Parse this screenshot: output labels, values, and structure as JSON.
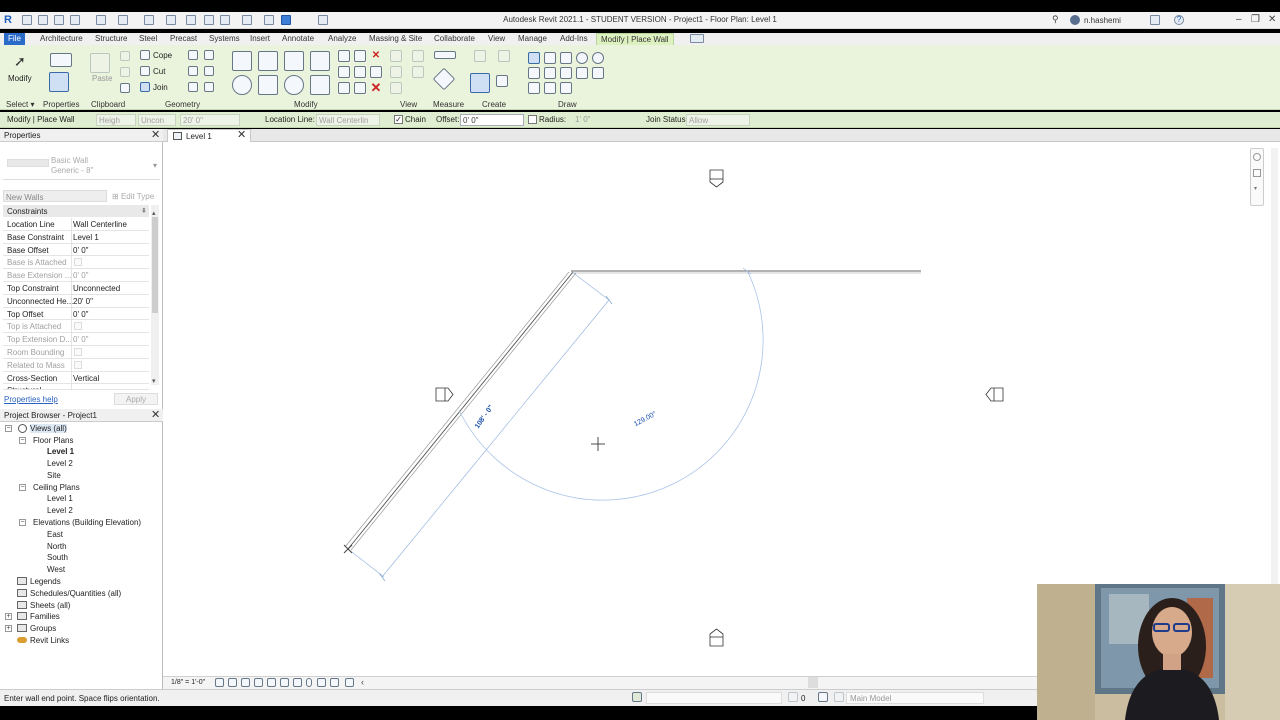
{
  "window": {
    "title": "Autodesk Revit 2021.1 - STUDENT VERSION - Project1 - Floor Plan: Level 1",
    "user": "n.hashemi"
  },
  "ribbon_tabs": [
    "File",
    "Architecture",
    "Structure",
    "Steel",
    "Precast",
    "Systems",
    "Insert",
    "Annotate",
    "Analyze",
    "Massing & Site",
    "Collaborate",
    "View",
    "Manage",
    "Add-Ins",
    "Modify | Place Wall"
  ],
  "ribbon": {
    "modify_label": "Modify",
    "paste_label": "Paste",
    "cope_label": "Cope",
    "cut_label": "Cut",
    "join_label": "Join",
    "panels": {
      "select": "Select",
      "properties": "Properties",
      "clipboard": "Clipboard",
      "geometry": "Geometry",
      "modify": "Modify",
      "view": "View",
      "measure": "Measure",
      "create": "Create",
      "draw": "Draw"
    }
  },
  "options_bar": {
    "context": "Modify | Place Wall",
    "height_label": "Heigh",
    "height_mode": "Uncon",
    "height_value": "20' 0\"",
    "location_line_label": "Location Line:",
    "location_line_value": "Wall Centerlin",
    "chain_label": "Chain",
    "chain_checked": true,
    "offset_label": "Offset:",
    "offset_value": "0' 0\"",
    "radius_label": "Radius:",
    "radius_checked": false,
    "radius_value": "1' 0\"",
    "join_status_label": "Join Status:",
    "join_status_value": "Allow"
  },
  "properties": {
    "title": "Properties",
    "type_family": "Basic Wall",
    "type_name": "Generic - 8\"",
    "instance_filter": "New Walls",
    "edit_type": "Edit Type",
    "section": "Constraints",
    "rows": [
      {
        "k": "Location Line",
        "v": "Wall Centerline"
      },
      {
        "k": "Base Constraint",
        "v": "Level 1"
      },
      {
        "k": "Base Offset",
        "v": "0' 0\""
      },
      {
        "k": "Base is Attached",
        "v": ""
      },
      {
        "k": "Base Extension ...",
        "v": "0' 0\""
      },
      {
        "k": "Top Constraint",
        "v": "Unconnected"
      },
      {
        "k": "Unconnected He...",
        "v": "20' 0\""
      },
      {
        "k": "Top Offset",
        "v": "0' 0\""
      },
      {
        "k": "Top is Attached",
        "v": ""
      },
      {
        "k": "Top Extension D...",
        "v": "0' 0\""
      },
      {
        "k": "Room Bounding",
        "v": ""
      },
      {
        "k": "Related to Mass",
        "v": ""
      },
      {
        "k": "Cross-Section",
        "v": "Vertical"
      },
      {
        "k": "Structural",
        "v": ""
      }
    ],
    "help_link": "Properties help",
    "apply_button": "Apply"
  },
  "project_browser": {
    "title": "Project Browser - Project1",
    "views_all": "Views (all)",
    "floor_plans": "Floor Plans",
    "fp_level1": "Level 1",
    "fp_level2": "Level 2",
    "fp_site": "Site",
    "ceiling_plans": "Ceiling Plans",
    "cp_level1": "Level 1",
    "cp_level2": "Level 2",
    "elevations": "Elevations (Building Elevation)",
    "el_east": "East",
    "el_north": "North",
    "el_south": "South",
    "el_west": "West",
    "legends": "Legends",
    "schedules": "Schedules/Quantities (all)",
    "sheets": "Sheets (all)",
    "families": "Families",
    "groups": "Groups",
    "revit_links": "Revit Links"
  },
  "view": {
    "tab_label": "Level 1",
    "scale": "1/8\" = 1'-0\"",
    "temp_dim_length": "108' - 0\"",
    "temp_dim_angle": "129.00°"
  },
  "status_bar": {
    "message": "Enter wall end point. Space flips orientation.",
    "worksets_value": "0",
    "design_option": "Main Model"
  },
  "colors": {
    "file_tab": "#2a6ac8",
    "contextual_tab": "#ddf0c0",
    "ribbon_bg": "#eaf3dc",
    "temp_dim": "#1a4fb0",
    "preview_line": "#9ab7e0"
  }
}
